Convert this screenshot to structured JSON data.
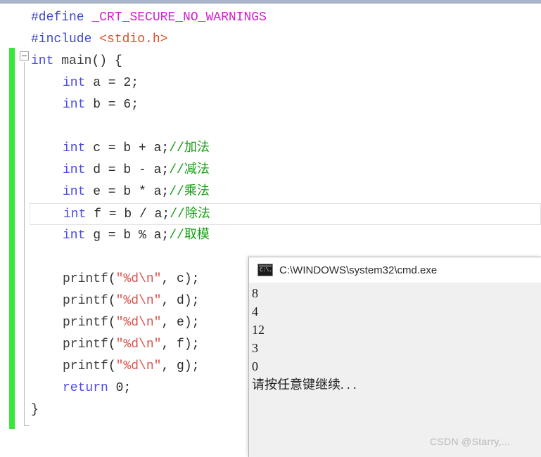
{
  "editor": {
    "change_bar_color": "#39e639",
    "current_line_index": 9,
    "outline_toggle": "collapse-minus",
    "lines": [
      {
        "indent": 0,
        "tokens": [
          {
            "text": "#define",
            "cls": "t-hash"
          },
          {
            "text": " ",
            "cls": "t-plain"
          },
          {
            "text": "_CRT_SECURE_NO_WARNINGS",
            "cls": "t-macro"
          }
        ]
      },
      {
        "indent": 0,
        "tokens": [
          {
            "text": "#include",
            "cls": "t-hash"
          },
          {
            "text": " ",
            "cls": "t-plain"
          },
          {
            "text": "<stdio.h>",
            "cls": "t-header"
          }
        ]
      },
      {
        "indent": 0,
        "tokens": [
          {
            "text": "int",
            "cls": "t-kw"
          },
          {
            "text": " ",
            "cls": "t-plain"
          },
          {
            "text": "main",
            "cls": "t-fn"
          },
          {
            "text": "() {",
            "cls": "t-brace"
          }
        ]
      },
      {
        "indent": 1,
        "tokens": [
          {
            "text": "int",
            "cls": "t-kw"
          },
          {
            "text": " a = ",
            "cls": "t-plain"
          },
          {
            "text": "2",
            "cls": "t-num"
          },
          {
            "text": ";",
            "cls": "t-plain"
          }
        ]
      },
      {
        "indent": 1,
        "tokens": [
          {
            "text": "int",
            "cls": "t-kw"
          },
          {
            "text": " b = ",
            "cls": "t-plain"
          },
          {
            "text": "6",
            "cls": "t-num"
          },
          {
            "text": ";",
            "cls": "t-plain"
          }
        ]
      },
      {
        "indent": 1,
        "tokens": [
          {
            "text": " ",
            "cls": "t-plain"
          }
        ]
      },
      {
        "indent": 1,
        "tokens": [
          {
            "text": "int",
            "cls": "t-kw"
          },
          {
            "text": " c = b + a;",
            "cls": "t-plain"
          },
          {
            "text": "//加法",
            "cls": "t-comment"
          }
        ]
      },
      {
        "indent": 1,
        "tokens": [
          {
            "text": "int",
            "cls": "t-kw"
          },
          {
            "text": " d = b - a;",
            "cls": "t-plain"
          },
          {
            "text": "//减法",
            "cls": "t-comment"
          }
        ]
      },
      {
        "indent": 1,
        "tokens": [
          {
            "text": "int",
            "cls": "t-kw"
          },
          {
            "text": " e = b * a;",
            "cls": "t-plain"
          },
          {
            "text": "//乘法",
            "cls": "t-comment"
          }
        ]
      },
      {
        "indent": 1,
        "current": true,
        "tokens": [
          {
            "text": "int",
            "cls": "t-kw"
          },
          {
            "text": " f = b / a;",
            "cls": "t-plain"
          },
          {
            "text": "//除法",
            "cls": "t-comment"
          }
        ]
      },
      {
        "indent": 1,
        "tokens": [
          {
            "text": "int",
            "cls": "t-kw"
          },
          {
            "text": " g = b % a;",
            "cls": "t-plain"
          },
          {
            "text": "//取模",
            "cls": "t-comment"
          }
        ]
      },
      {
        "indent": 1,
        "tokens": [
          {
            "text": " ",
            "cls": "t-plain"
          }
        ]
      },
      {
        "indent": 1,
        "tokens": [
          {
            "text": "printf",
            "cls": "t-fn"
          },
          {
            "text": "(",
            "cls": "t-plain"
          },
          {
            "text": "\"%d\\n\"",
            "cls": "t-str"
          },
          {
            "text": ", c);",
            "cls": "t-plain"
          }
        ]
      },
      {
        "indent": 1,
        "tokens": [
          {
            "text": "printf",
            "cls": "t-fn"
          },
          {
            "text": "(",
            "cls": "t-plain"
          },
          {
            "text": "\"%d\\n\"",
            "cls": "t-str"
          },
          {
            "text": ", d);",
            "cls": "t-plain"
          }
        ]
      },
      {
        "indent": 1,
        "tokens": [
          {
            "text": "printf",
            "cls": "t-fn"
          },
          {
            "text": "(",
            "cls": "t-plain"
          },
          {
            "text": "\"%d\\n\"",
            "cls": "t-str"
          },
          {
            "text": ", e);",
            "cls": "t-plain"
          }
        ]
      },
      {
        "indent": 1,
        "tokens": [
          {
            "text": "printf",
            "cls": "t-fn"
          },
          {
            "text": "(",
            "cls": "t-plain"
          },
          {
            "text": "\"%d\\n\"",
            "cls": "t-str"
          },
          {
            "text": ", f);",
            "cls": "t-plain"
          }
        ]
      },
      {
        "indent": 1,
        "tokens": [
          {
            "text": "printf",
            "cls": "t-fn"
          },
          {
            "text": "(",
            "cls": "t-plain"
          },
          {
            "text": "\"%d\\n\"",
            "cls": "t-str"
          },
          {
            "text": ", g);",
            "cls": "t-plain"
          }
        ]
      },
      {
        "indent": 1,
        "tokens": [
          {
            "text": "return",
            "cls": "t-kw"
          },
          {
            "text": " ",
            "cls": "t-plain"
          },
          {
            "text": "0",
            "cls": "t-num"
          },
          {
            "text": ";",
            "cls": "t-plain"
          }
        ]
      },
      {
        "indent": 0,
        "tokens": [
          {
            "text": "}",
            "cls": "t-brace"
          }
        ]
      }
    ]
  },
  "console": {
    "icon": "cmd-icon",
    "title": "C:\\WINDOWS\\system32\\cmd.exe",
    "output": "8\n4\n12\n3\n0\n请按任意键继续. . ."
  },
  "watermark": {
    "text": "CSDN @Starry,..."
  }
}
